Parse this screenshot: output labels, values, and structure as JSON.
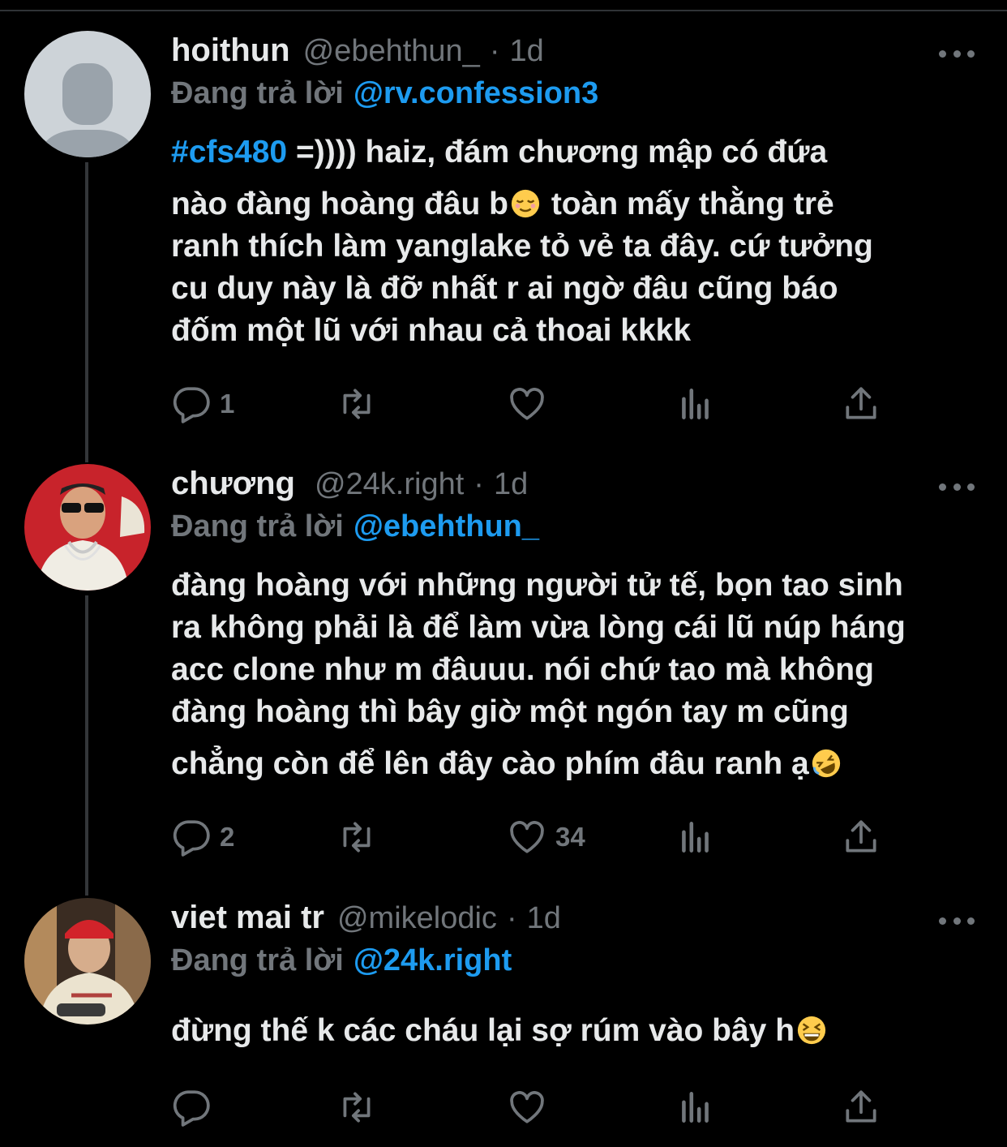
{
  "tweets": [
    {
      "name": "hoithun",
      "handle": "@ebehthun_",
      "sep": "·",
      "time": "1d",
      "replying_label": "Đang trả lời",
      "replying_to": "@rv.confession3",
      "hashtag": "#cfs480",
      "lines": [
        " =)))) haiz, đám chương mập có đứa",
        "nào đàng hoàng đâu b",
        " toàn mấy thằng trẻ",
        "ranh thích làm yanglake tỏ vẻ ta đây. cứ tưởng",
        "cu duy này là đỡ nhất r ai ngờ đâu cũng báo",
        "đốm một lũ với nhau cả thoai kkkk"
      ],
      "counts": {
        "reply": "1",
        "retweet": "",
        "like": ""
      }
    },
    {
      "name": "chương",
      "handle": "@24k.right",
      "sep": "·",
      "time": "1d",
      "replying_label": "Đang trả lời",
      "replying_to": "@ebehthun_",
      "lines": [
        "đàng hoàng với những người tử tế, bọn tao sinh",
        "ra không phải là để làm vừa lòng cái lũ núp háng",
        "acc clone như m đâuuu. nói chứ tao mà không",
        "đàng hoàng thì bây giờ một ngón tay m cũng",
        "chẳng còn để lên đây cào phím đâu ranh ạ"
      ],
      "counts": {
        "reply": "2",
        "retweet": "",
        "like": "34"
      }
    },
    {
      "name": "viet mai tr",
      "handle": "@mikelodic",
      "sep": "·",
      "time": "1d",
      "replying_label": "Đang trả lời",
      "replying_to": "@24k.right",
      "lines": [
        "đừng thế k các cháu lại sợ rúm vào bây h"
      ],
      "counts": {
        "reply": "",
        "retweet": "",
        "like": ""
      }
    }
  ],
  "icons": [
    "reply-icon",
    "retweet-icon",
    "like-icon",
    "analytics-icon",
    "share-icon",
    "more-icon",
    "relieved-face-emoji",
    "rofl-emoji",
    "grinning-squint-emoji"
  ],
  "colors": {
    "background": "#000000",
    "text": "#e7e9ea",
    "muted": "#71767b",
    "accent": "#1d9bf0",
    "thread": "#333639"
  }
}
